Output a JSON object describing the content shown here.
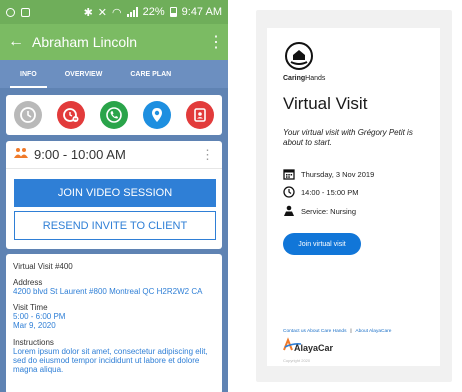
{
  "status_bar": {
    "battery": "22%",
    "time": "9:47 AM"
  },
  "app_bar": {
    "title": "Abraham Lincoln",
    "back_icon": "arrow-left-icon",
    "more_icon": "more-vert-icon"
  },
  "tabs": [
    {
      "label": "INFO",
      "active": true
    },
    {
      "label": "OVERVIEW",
      "active": false
    },
    {
      "label": "CARE PLAN",
      "active": false
    }
  ],
  "actions": [
    {
      "icon": "clock-icon",
      "color": "#b9b9b9"
    },
    {
      "icon": "clock-off-icon",
      "color": "#e23b3b"
    },
    {
      "icon": "phone-icon",
      "color": "#2aa44a"
    },
    {
      "icon": "location-pin-icon",
      "color": "#1e8fe0"
    },
    {
      "icon": "contact-card-icon",
      "color": "#e23b3b"
    }
  ],
  "visit": {
    "time_range": "9:00 - 10:00 AM",
    "join_label": "JOIN VIDEO SESSION",
    "resend_label": "RESEND INVITE TO CLIENT",
    "number": "Virtual Visit #400",
    "address_label": "Address",
    "address": "4200 blvd St Laurent #800 Montreal QC H2R2W2 CA",
    "visit_time_label": "Visit Time",
    "visit_time": "5:00 - 6:00 PM",
    "visit_date": "Mar 9, 2020",
    "instructions_label": "Instructions",
    "instructions": "Lorem ipsum dolor sit amet, consectetur adipiscing elit, sed do eiusmod tempor incididunt ut labore et dolore magna aliqua."
  },
  "web": {
    "brand_bold": "Caring",
    "brand_rest": "Hands",
    "title": "Virtual Visit",
    "message": "Your virtual visit with Grégory Petit is about to start.",
    "date": "Thursday, 3 Nov 2019",
    "time": "14:00 - 15:00 PM",
    "service": "Service: Nursing",
    "join_label": "Join virtual visit",
    "footer_contact": "Contact us",
    "footer_about_care": "About Care Hands",
    "footer_sep": "||",
    "footer_about_alaya": "About AlayaCare",
    "alaya_logo_text": "AlayaCare",
    "copyright": "Copyright 2020"
  },
  "colors": {
    "primary_blue": "#2f7fd6",
    "green_bar": "#7bbb63",
    "phone_bg": "#5f83b3"
  }
}
